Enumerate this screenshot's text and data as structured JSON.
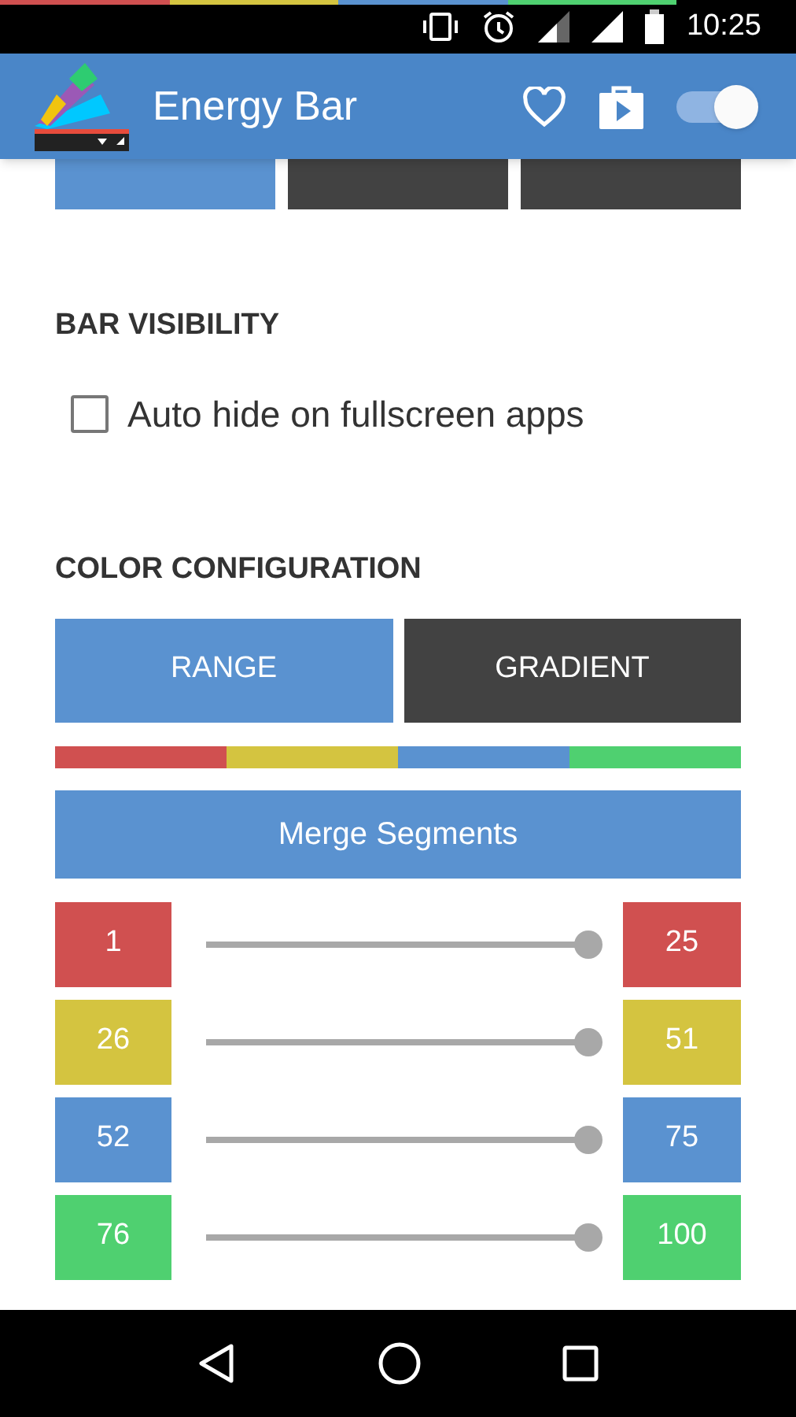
{
  "status_bar": {
    "time": "10:25"
  },
  "app_bar": {
    "title": "Energy Bar",
    "toggle_on": true
  },
  "position_buttons": [
    {
      "selected": true
    },
    {
      "selected": false
    },
    {
      "selected": false
    }
  ],
  "bar_visibility": {
    "heading": "BAR VISIBILITY",
    "checkbox": {
      "label": "Auto hide on fullscreen apps",
      "checked": false
    }
  },
  "color_configuration": {
    "heading": "COLOR CONFIGURATION",
    "modes": [
      {
        "label": "RANGE",
        "selected": true
      },
      {
        "label": "GRADIENT",
        "selected": false
      }
    ],
    "merge_button": "Merge Segments",
    "segments": [
      {
        "from": "1",
        "to": "25",
        "color": "#d05050",
        "level": 1
      },
      {
        "from": "26",
        "to": "51",
        "color": "#d4c440",
        "level": 1
      },
      {
        "from": "52",
        "to": "75",
        "color": "#5a92d0",
        "level": 1
      },
      {
        "from": "76",
        "to": "100",
        "color": "#4fd070",
        "level": 1
      }
    ]
  }
}
